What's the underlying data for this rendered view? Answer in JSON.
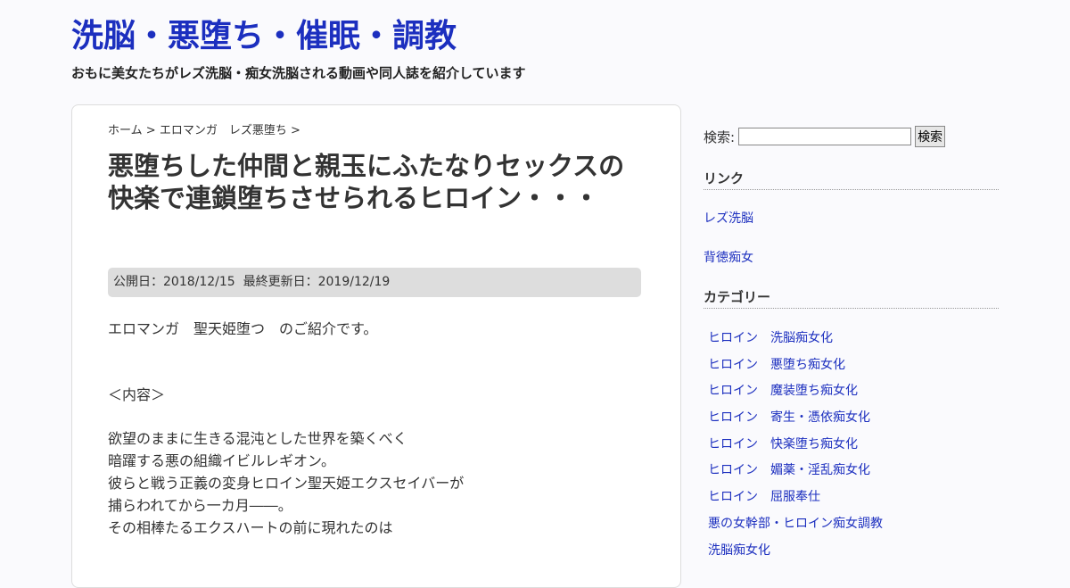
{
  "site": {
    "title": "洗脳・悪堕ち・催眠・調教",
    "description": "おもに美女たちがレズ洗脳・痴女洗脳される動画や同人誌を紹介しています"
  },
  "breadcrumb": {
    "home": "ホーム",
    "separator": ">",
    "category": "エロマンガ　レズ悪堕ち",
    "trailing": ">"
  },
  "post": {
    "title": "悪堕ちした仲間と親玉にふたなりセックスの快楽で連鎖堕ちさせられるヒロイン・・・",
    "published_label": "公開日：",
    "published": "2018/12/15",
    "updated_label": "最終更新日：",
    "updated": "2019/12/19",
    "intro": "エロマンガ　聖天姫堕つ　のご紹介です。",
    "section_heading": "＜内容＞",
    "body_lines": [
      "欲望のままに生きる混沌とした世界を築くべく",
      "暗躍する悪の組織イビルレギオン。",
      "彼らと戦う正義の変身ヒロイン聖天姫エクスセイバーが",
      "捕らわれてから一カ月――。",
      "その相棒たるエクスハートの前に現れたのは"
    ]
  },
  "sidebar": {
    "search_label": "検索:",
    "search_value": "",
    "search_button": "検索",
    "links_title": "リンク",
    "links": [
      "レズ洗脳",
      "背徳痴女"
    ],
    "categories_title": "カテゴリー",
    "categories": [
      "ヒロイン　洗脳痴女化",
      "ヒロイン　悪堕ち痴女化",
      "ヒロイン　魔装堕ち痴女化",
      "ヒロイン　寄生・憑依痴女化",
      "ヒロイン　快楽堕ち痴女化",
      "ヒロイン　媚薬・淫乱痴女化",
      "ヒロイン　屈服奉仕",
      "悪の女幹部・ヒロイン痴女調教",
      "洗脳痴女化"
    ]
  },
  "colors": {
    "accent": "#1c2fbf",
    "text": "#333333",
    "date_bar": "#dddddd"
  }
}
